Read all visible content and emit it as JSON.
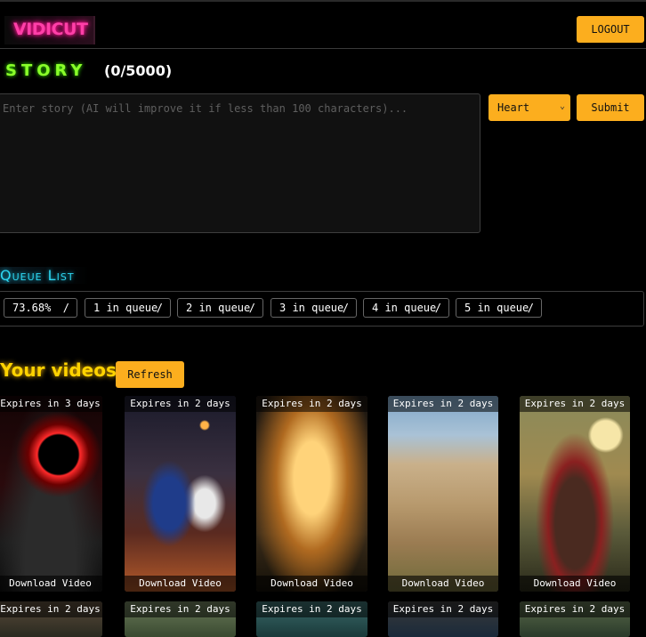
{
  "header": {
    "logo_text": "VIDICUT",
    "logout_label": "LOGOUT"
  },
  "story": {
    "title": "STORY",
    "count": "(0/5000)",
    "input_value": "",
    "input_placeholder": "Enter story (AI will improve it if less than 100 characters)...",
    "voice_selected": "Heart",
    "submit_label": "Submit"
  },
  "queue": {
    "title": "Queue List",
    "items": [
      {
        "label": "73.68%",
        "sep": "/"
      },
      {
        "label": "1 in queue",
        "sep": "/"
      },
      {
        "label": "2 in queue",
        "sep": "/"
      },
      {
        "label": "3 in queue",
        "sep": "/"
      },
      {
        "label": "4 in queue",
        "sep": "/"
      },
      {
        "label": "5 in queue",
        "sep": "/"
      }
    ]
  },
  "videos": {
    "title": "Your videos",
    "refresh_label": "Refresh",
    "items": [
      {
        "expires": "Expires in 3 days",
        "download": "Download Video",
        "thumb": "red-portal-figures"
      },
      {
        "expires": "Expires in 2 days",
        "download": "Download Video",
        "thumb": "basketball-game"
      },
      {
        "expires": "Expires in 2 days",
        "download": "Download Video",
        "thumb": "tunnel-figure"
      },
      {
        "expires": "Expires in 2 days",
        "download": "Download Video",
        "thumb": "ancient-city"
      },
      {
        "expires": "Expires in 2 days",
        "download": "Download Video",
        "thumb": "warrior-ruins"
      }
    ],
    "row2": [
      {
        "expires": "Expires in 2 days"
      },
      {
        "expires": "Expires in 2 days"
      },
      {
        "expires": "Expires in 2 days"
      },
      {
        "expires": "Expires in 2 days"
      },
      {
        "expires": "Expires in 2 days"
      }
    ]
  },
  "colors": {
    "accent_yellow": "#fcae1e",
    "logo_pink": "#ff3fa8",
    "story_green": "#8aff2a",
    "queue_cyan": "#2ed6f0",
    "videos_yellow": "#ffd300"
  }
}
